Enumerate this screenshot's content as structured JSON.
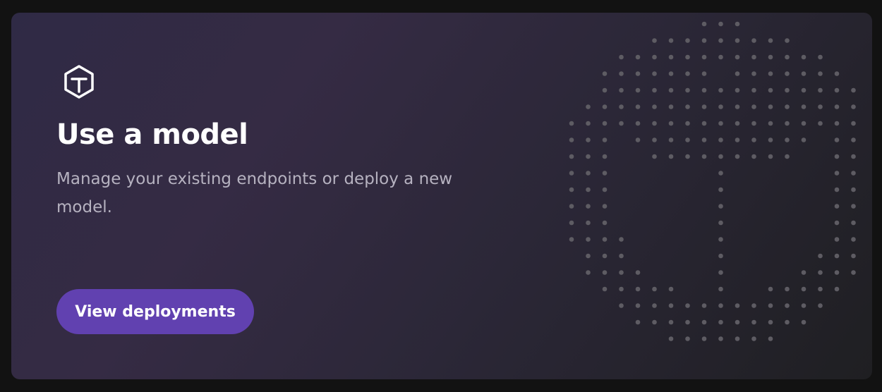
{
  "card": {
    "icon": "cube-icon",
    "title": "Use a model",
    "description": "Manage your existing endpoints or deploy a new model.",
    "button_label": "View deployments",
    "accent_color": "#6141b0",
    "background_decoration": "dot-matrix-cube-pattern"
  }
}
